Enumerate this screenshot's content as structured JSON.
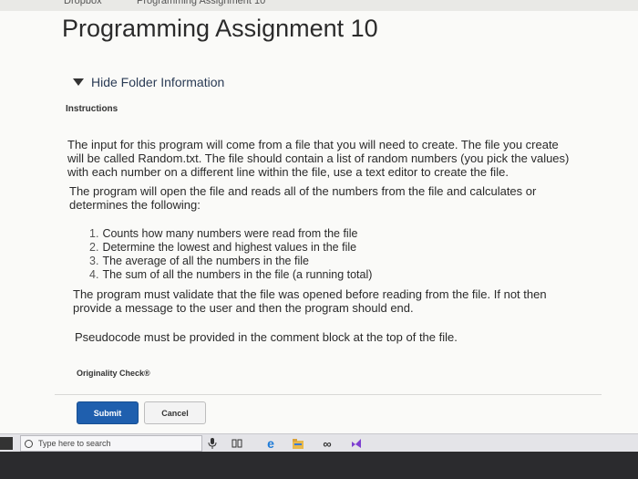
{
  "page": {
    "title": "Programming Assignment 10"
  },
  "folder": {
    "toggle_label": "Hide Folder Information"
  },
  "instructions": {
    "heading": "Instructions",
    "paragraph1": "The input for this program will come from a file that you will need to create. The file you create will be called Random.txt. The file should contain a list of random numbers (you pick the values) with each number on a different line within the file, use a text editor to create the file.",
    "paragraph2": "The program will open the file and reads all of the numbers from the file and calculates or determines the following:",
    "list": [
      {
        "num": "1.",
        "text": "Counts how many numbers were read from the file"
      },
      {
        "num": "2.",
        "text": "Determine the lowest and highest values in the file"
      },
      {
        "num": "3.",
        "text": "The average of all the numbers in the file"
      },
      {
        "num": "4.",
        "text": "The sum of all the numbers in the file (a running total)"
      }
    ],
    "paragraph3": "The program must validate that the file was opened before reading from the file. If not then provide a message to the user and then the program should end.",
    "paragraph4": "Pseudocode must be provided in the comment block at the top of the file."
  },
  "originality": {
    "label": "Originality Check®"
  },
  "buttons": {
    "submit": "Submit",
    "cancel": "Cancel"
  },
  "taskbar": {
    "search_placeholder": "Type here to search",
    "icons": [
      "microphone-icon",
      "task-view-icon",
      "edge-icon",
      "file-explorer-icon",
      "infinity-app-icon",
      "visual-studio-icon"
    ]
  },
  "colors": {
    "submit_bg": "#1f5fae",
    "taskbar_bg": "#e4e4e8",
    "edge_blue": "#1e7bd8",
    "vs_purple": "#7e3fd1"
  }
}
